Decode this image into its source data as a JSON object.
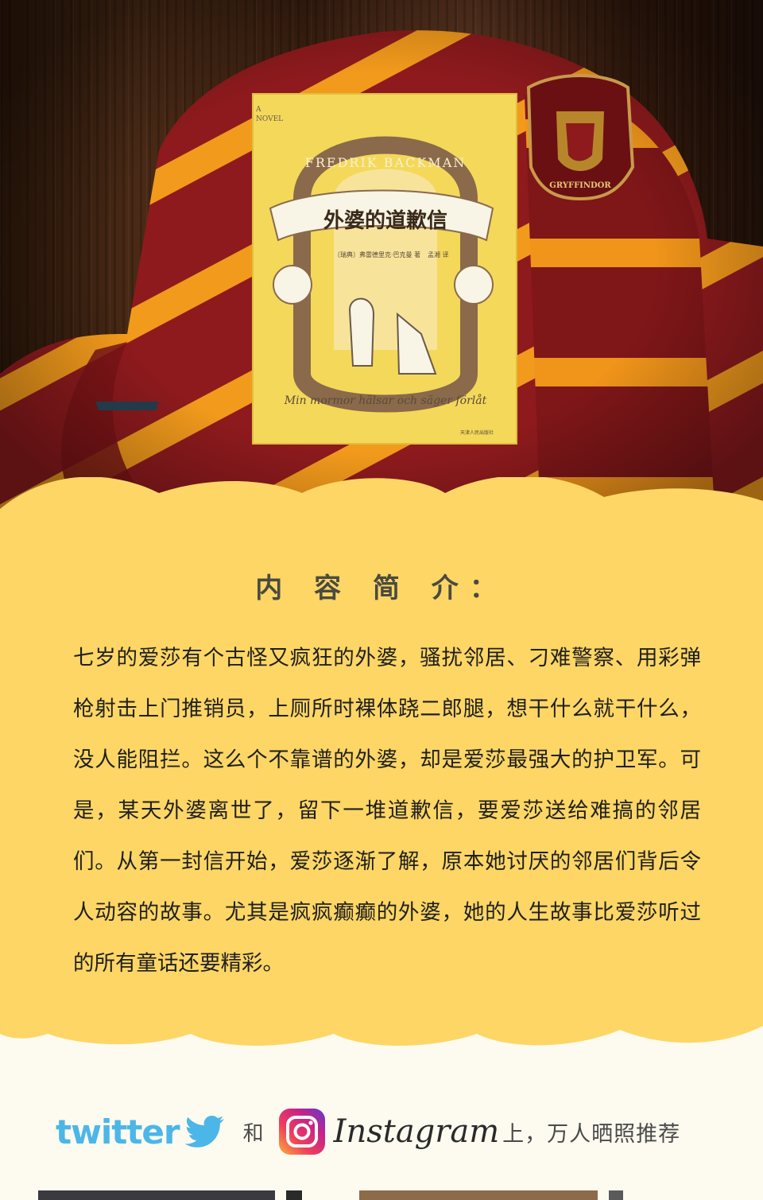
{
  "book": {
    "title_cn": "外婆的道歉信",
    "author_en": "FREDRIK BACKMAN",
    "novel_tag_a": "A",
    "novel_tag_b": "NOVEL",
    "credit_line": "〔瑞典〕弗雷德里克·巴克曼 著",
    "translator": "孟湘 译",
    "swedish_title": "Min mormor hälsar och säger förlåt",
    "publisher": "天津人民出版社"
  },
  "badge": {
    "label": "GRYFFINDOR"
  },
  "intro": {
    "title": "内 容 简 介：",
    "paragraph": "七岁的爱莎有个古怪又疯狂的外婆，骚扰邻居、刁难警察、用彩弹枪射击上门推销员，上厕所时裸体跷二郎腿，想干什么就干什么，没人能阻拦。这么个不靠谱的外婆，却是爱莎最强大的护卫军。可是，某天外婆离世了，留下一堆道歉信，要爱莎送给难搞的邻居们。从第一封信开始，爱莎逐渐了解，原本她讨厌的邻居们背后令人动容的故事。尤其是疯疯癫癫的外婆，她的人生故事比爱莎听过的所有童话还要精彩。"
  },
  "social": {
    "twitter_label": "twitter",
    "and_label": "和",
    "instagram_label": "Instagram",
    "recommend_label": "上，万人晒照推荐"
  },
  "colors": {
    "panel_yellow": "#fdd665",
    "scarf_red": "#8e1a1d",
    "scarf_gold": "#f29a1c",
    "book_yellow": "#f4d85a",
    "twitter_blue": "#4cb6e8"
  },
  "icons": [
    "twitter-bird-icon",
    "instagram-icon",
    "gryffindor-crest-icon"
  ]
}
